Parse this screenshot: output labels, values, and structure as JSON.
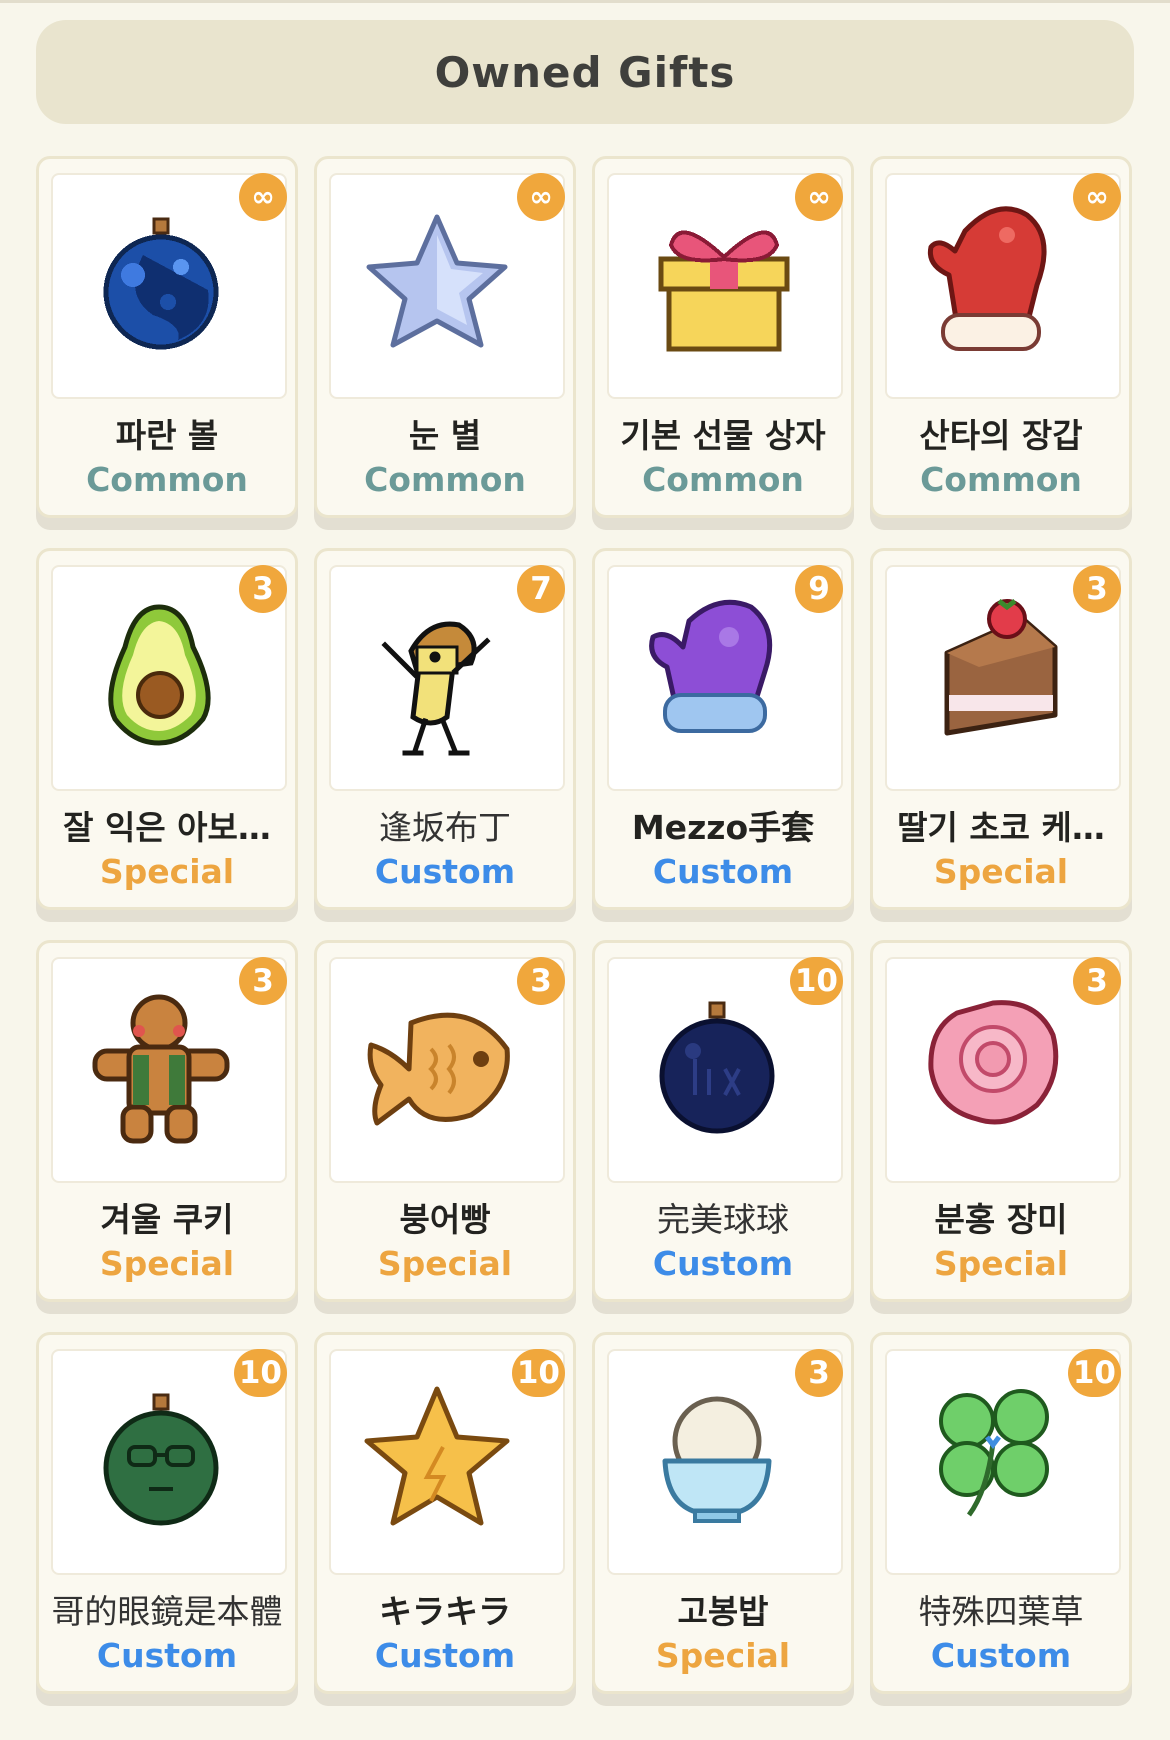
{
  "header": {
    "title": "Owned Gifts"
  },
  "colors": {
    "common": "#6b9a98",
    "special": "#eda540",
    "custom": "#3d8ce8",
    "badge": "#f0a73c"
  },
  "gifts": [
    {
      "name": "파란 볼",
      "rarity": "Common",
      "count": "∞",
      "icon": "blue-ornament-icon"
    },
    {
      "name": "눈 별",
      "rarity": "Common",
      "count": "∞",
      "icon": "snow-star-icon"
    },
    {
      "name": "기본 선물 상자",
      "rarity": "Common",
      "count": "∞",
      "icon": "gift-box-icon"
    },
    {
      "name": "산타의 장갑",
      "rarity": "Common",
      "count": "∞",
      "icon": "red-mitten-icon"
    },
    {
      "name": "잘 익은 아보…",
      "rarity": "Special",
      "count": "3",
      "icon": "avocado-icon"
    },
    {
      "name": "逢坂布丁",
      "rarity": "Custom",
      "count": "7",
      "icon": "pudding-character-icon"
    },
    {
      "name": "Mezzo手套",
      "rarity": "Custom",
      "count": "9",
      "icon": "purple-mitten-icon"
    },
    {
      "name": "딸기 초코 케…",
      "rarity": "Special",
      "count": "3",
      "icon": "strawberry-cake-icon"
    },
    {
      "name": "겨울 쿠키",
      "rarity": "Special",
      "count": "3",
      "icon": "gingerbread-icon"
    },
    {
      "name": "붕어빵",
      "rarity": "Special",
      "count": "3",
      "icon": "fish-bread-icon"
    },
    {
      "name": "完美球球",
      "rarity": "Custom",
      "count": "10",
      "icon": "navy-ornament-icon"
    },
    {
      "name": "분홍 장미",
      "rarity": "Special",
      "count": "3",
      "icon": "pink-rose-icon"
    },
    {
      "name": "哥的眼鏡是本體",
      "rarity": "Custom",
      "count": "10",
      "icon": "green-glasses-ornament-icon"
    },
    {
      "name": "キラキラ",
      "rarity": "Custom",
      "count": "10",
      "icon": "gold-star-icon"
    },
    {
      "name": "고봉밥",
      "rarity": "Special",
      "count": "3",
      "icon": "rice-bowl-icon"
    },
    {
      "name": "特殊四葉草",
      "rarity": "Custom",
      "count": "10",
      "icon": "four-leaf-clover-icon"
    }
  ]
}
